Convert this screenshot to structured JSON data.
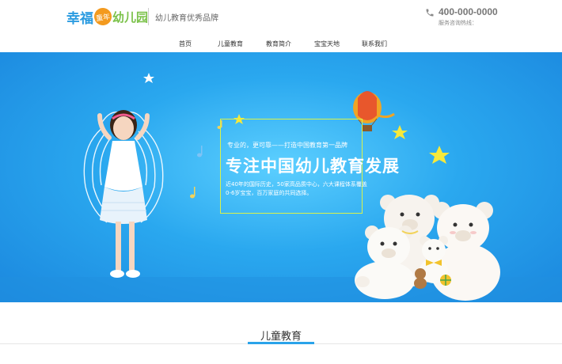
{
  "header": {
    "logo": {
      "part1": "幸福",
      "part2": "童年",
      "part3": "幼儿园"
    },
    "slogan": "幼儿教育优秀品牌",
    "phone": "400-000-0000",
    "phone_label": "服务咨询热线："
  },
  "nav": {
    "items": [
      {
        "label": "首页"
      },
      {
        "label": "儿童教育"
      },
      {
        "label": "教育简介"
      },
      {
        "label": "宝宝天地"
      },
      {
        "label": "联系我们"
      }
    ]
  },
  "banner": {
    "subtitle": "专业的，更可靠——打造中国教育第一品牌",
    "title": "专注中国幼儿教育发展",
    "desc_lines": [
      "近40年的国际历史，50家高品质中心，六大课程体系覆盖",
      "0-6岁宝宝，百万家庭的共同选择。"
    ],
    "colors": {
      "primary": "#2aa8ef",
      "frame": "#d9f24a"
    }
  },
  "section": {
    "title": "儿童教育",
    "accent": "#2aa3ea"
  }
}
